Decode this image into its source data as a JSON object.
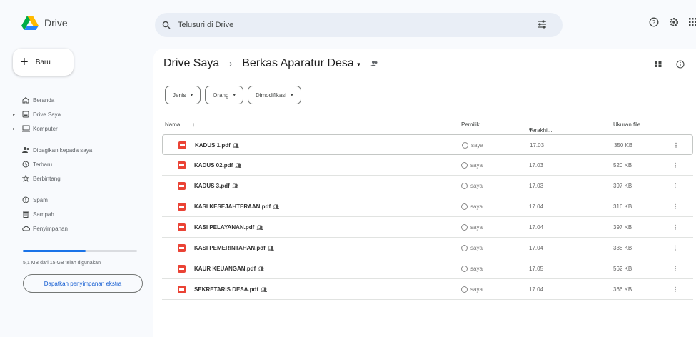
{
  "app": {
    "name": "Drive"
  },
  "search": {
    "placeholder": "Telusuri di Drive"
  },
  "sidebar": {
    "new_label": "Baru",
    "items": [
      {
        "label": "Beranda"
      },
      {
        "label": "Drive Saya"
      },
      {
        "label": "Komputer"
      },
      {
        "label": "Dibagikan kepada saya"
      },
      {
        "label": "Terbaru"
      },
      {
        "label": "Berbintang"
      },
      {
        "label": "Spam"
      },
      {
        "label": "Sampah"
      },
      {
        "label": "Penyimpanan"
      }
    ],
    "storage_text": "5,1 MB dari 15 GB telah digunakan",
    "storage_fraction": 0.55,
    "buy_label": "Dapatkan penyimpanan ekstra"
  },
  "breadcrumb": {
    "root": "Drive Saya",
    "separator": "›",
    "current": "Berkas Aparatur Desa"
  },
  "filters": [
    "Jenis",
    "Orang",
    "Dimodifikasi"
  ],
  "table": {
    "headers": {
      "name": "Nama",
      "owner": "Pemilik",
      "modified": "Terakhi...",
      "size": "Ukuran file"
    },
    "rows": [
      {
        "name": "KADUS 1.pdf",
        "owner": "saya",
        "modified": "17.03",
        "size": "350 KB"
      },
      {
        "name": "KADUS 02.pdf",
        "owner": "saya",
        "modified": "17.03",
        "size": "520 KB"
      },
      {
        "name": "KADUS 3.pdf",
        "owner": "saya",
        "modified": "17.03",
        "size": "397 KB"
      },
      {
        "name": "KASI KESEJAHTERAAN.pdf",
        "owner": "saya",
        "modified": "17.04",
        "size": "316 KB"
      },
      {
        "name": "KASI PELAYANAN.pdf",
        "owner": "saya",
        "modified": "17.04",
        "size": "397 KB"
      },
      {
        "name": "KASI PEMERINTAHAN.pdf",
        "owner": "saya",
        "modified": "17.04",
        "size": "338 KB"
      },
      {
        "name": "KAUR KEUANGAN.pdf",
        "owner": "saya",
        "modified": "17.05",
        "size": "562 KB"
      },
      {
        "name": "SEKRETARIS DESA.pdf",
        "owner": "saya",
        "modified": "17.04",
        "size": "366 KB"
      }
    ]
  },
  "colors": {
    "accent": "#0b57d0",
    "pdf": "#ea4335",
    "bg": "#f8fafd",
    "search_bg": "#e9eef6"
  }
}
